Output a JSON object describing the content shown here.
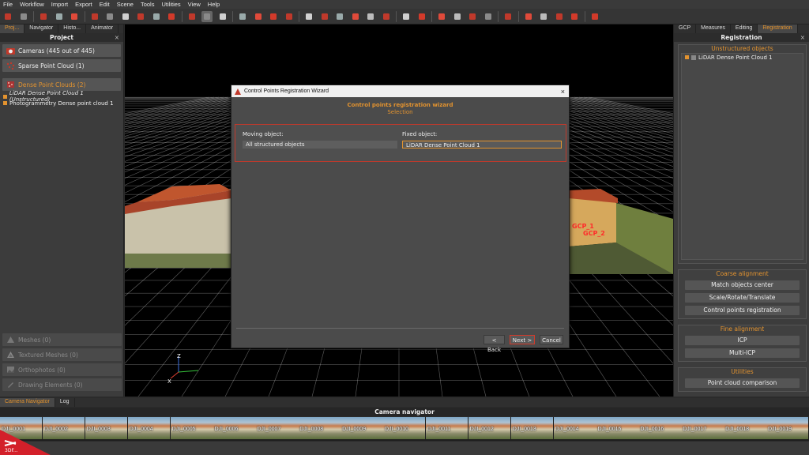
{
  "menu": [
    "File",
    "Workflow",
    "Import",
    "Export",
    "Edit",
    "Scene",
    "Tools",
    "Utilities",
    "View",
    "Help"
  ],
  "left_panel": {
    "tabs": [
      "Proj...",
      "Navigator",
      "Histo...",
      "Animator"
    ],
    "title": "Project",
    "close": "×",
    "cameras": "Cameras (445 out of 445)",
    "sparse": "Sparse Point Cloud (1)",
    "dense": "Dense Point Clouds (2)",
    "dense_items": [
      "LiDAR Dense Point Cloud 1 (Unstructured)",
      "Photogrammetry Dense point cloud 1"
    ],
    "meshes": "Meshes (0)",
    "textured": "Textured Meshes (0)",
    "ortho": "Orthophotos (0)",
    "drawing": "Drawing Elements (0)"
  },
  "right_panel": {
    "tabs": [
      "GCP",
      "Measures",
      "Editing",
      "Registration"
    ],
    "title": "Registration",
    "close": "×",
    "unstructured_title": "Unstructured objects",
    "unstructured_item": "LiDAR Dense Point Cloud 1",
    "coarse_title": "Coarse alignment",
    "coarse_buttons": [
      "Match objects center",
      "Scale/Rotate/Translate",
      "Control points registration"
    ],
    "fine_title": "Fine alignment",
    "fine_buttons": [
      "ICP",
      "Multi-ICP"
    ],
    "utilities_title": "Utilities",
    "utilities_buttons": [
      "Point cloud comparison"
    ]
  },
  "viewport": {
    "gcp_labels": [
      "GCP_1",
      "GCP_2"
    ],
    "axes": {
      "z": "Z",
      "x": "X"
    }
  },
  "dialog": {
    "title": "Control Points Registration Wizard",
    "close": "×",
    "heading": "Control points registration wizard",
    "subheading": "Selection",
    "moving_label": "Moving object:",
    "moving_value": "All structured objects",
    "fixed_label": "Fixed object:",
    "fixed_value": "LiDAR Dense Point Cloud 1",
    "back": "< Back",
    "next": "Next >",
    "cancel": "Cancel"
  },
  "bottom": {
    "tabs": [
      "Camera Navigator",
      "Log"
    ],
    "title": "Camera navigator",
    "thumbnails": [
      "DJI_0001",
      "DJI_0002",
      "DJI_0003",
      "DJI_0004",
      "DJI_0005",
      "DJI_0006",
      "DJI_0007",
      "DJI_0008",
      "DJI_0009",
      "DJI_0010",
      "DJI_0011",
      "DJI_0012",
      "DJI_0013",
      "DJI_0014",
      "DJI_0015",
      "DJI_0016",
      "DJI_0017",
      "DJI_0018",
      "DJI_0019"
    ],
    "logo_text": "3DF..."
  },
  "toolbar_icons": [
    "app-icon",
    "save-icon",
    "sep",
    "orientation-icon",
    "points-icon",
    "mesh-icon",
    "sep",
    "camera-add-icon",
    "cube-icon",
    "cube-gear-icon",
    "cube-edit-icon",
    "cube-star-icon",
    "record-icon",
    "sep",
    "circle-icon",
    "square-active-icon",
    "cluster-icon",
    "sep",
    "tripod-icon",
    "terrain-icon",
    "terrain-red-icon",
    "brush-icon",
    "sep",
    "factory-icon",
    "target-icon",
    "target-grid-icon",
    "hexagon-icon",
    "hexagon-gear-icon",
    "hexagon-dots-icon",
    "sep",
    "undo-icon",
    "redo-icon",
    "sep",
    "rotate-icon",
    "crop-icon",
    "ruler-icon",
    "triangle-ruler-icon",
    "sep",
    "chart-icon",
    "sep",
    "code-icon",
    "gear-icon",
    "box-icon",
    "box-red-icon",
    "sep",
    "help-icon"
  ],
  "colors": {
    "accent": "#e3932f",
    "highlight": "#d23a2a",
    "panel": "#3c3c3c"
  }
}
